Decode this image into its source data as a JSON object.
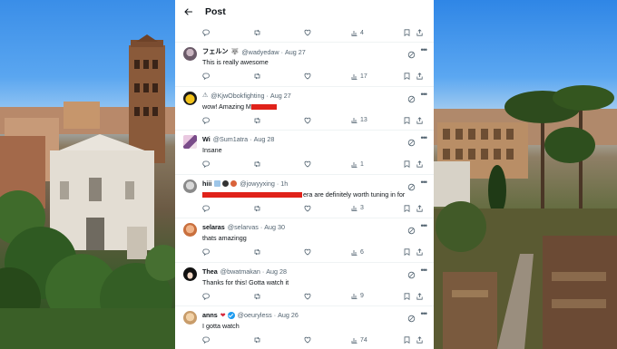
{
  "header": {
    "title": "Post"
  },
  "top_actions": {
    "views": "4"
  },
  "posts": [
    {
      "name": "フェルン",
      "handle": "@wadyedaw",
      "date": "Aug 27",
      "text": "This is really awesome",
      "views": "17"
    },
    {
      "name": "",
      "handle": "@KjwObokfighting",
      "date": "Aug 27",
      "text": "wow! Amazing M",
      "views": "13"
    },
    {
      "name": "Wi",
      "handle": "@Sum1atra",
      "date": "Aug 28",
      "text": "Insane",
      "views": "1"
    },
    {
      "name": "hiii",
      "handle": "@jowyyxing",
      "date": "1h",
      "text": "era are definitely worth tuning in for",
      "views": "3"
    },
    {
      "name": "selaras",
      "handle": "@selarvas",
      "date": "Aug 30",
      "text": "thats amazingg",
      "views": "6"
    },
    {
      "name": "Thea",
      "handle": "@bwatmakan",
      "date": "Aug 28",
      "text": "Thanks for this! Gotta watch it",
      "views": "9"
    },
    {
      "name": "anns",
      "handle": "@oeuryless",
      "date": "Aug 26",
      "text": "I gotta watch",
      "views": "74"
    }
  ],
  "colors": {
    "accent": "#1d9bf0",
    "text": "#0f1419",
    "muted": "#536471",
    "redaction": "#e0221a"
  },
  "icons": [
    "back-arrow-icon",
    "reply-icon",
    "repost-icon",
    "like-icon",
    "views-icon",
    "bookmark-icon",
    "share-icon",
    "grok-icon",
    "more-icon",
    "verified-icon"
  ]
}
